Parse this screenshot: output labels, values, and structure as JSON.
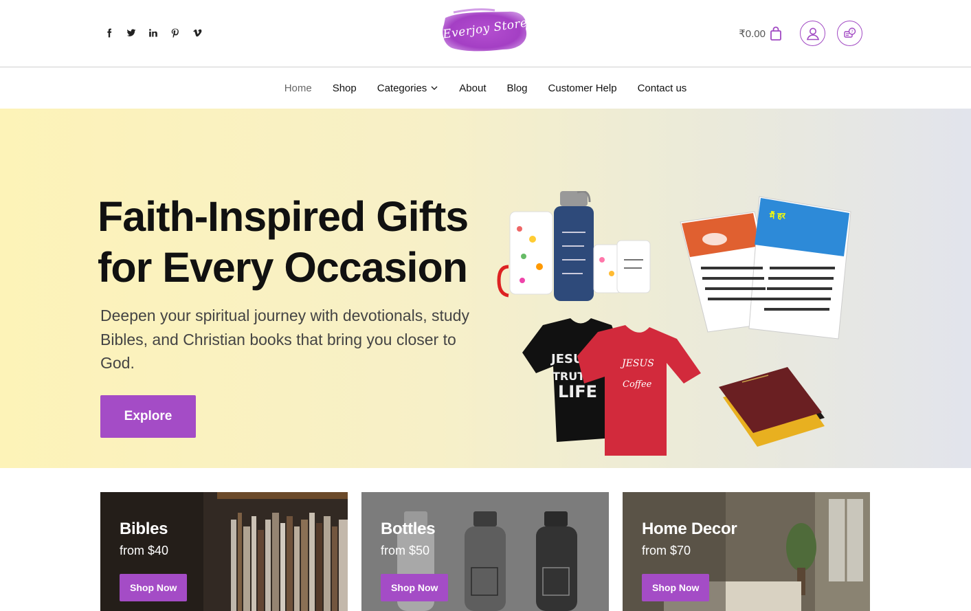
{
  "header": {
    "social_icons": [
      "facebook-icon",
      "twitter-icon",
      "linkedin-icon",
      "pinterest-icon",
      "vimeo-icon"
    ],
    "logo_text": "Everjoy Store",
    "cart_amount": "₹0.00",
    "icons": [
      "shopping-bag-icon",
      "user-account-icon",
      "support-chat-icon"
    ]
  },
  "nav": {
    "items": [
      "Home",
      "Shop",
      "Categories",
      "About",
      "Blog",
      "Customer Help",
      "Contact us"
    ]
  },
  "hero": {
    "title_line1": "Faith-Inspired Gifts",
    "title_line2": "for Every Occasion",
    "subtitle": "Deepen your spiritual journey with devotionals, study Bibles, and Christian books that bring you closer to God.",
    "button": "Explore"
  },
  "cards": [
    {
      "title": "Bibles",
      "price": "from $40",
      "button": "Shop Now"
    },
    {
      "title": "Bottles",
      "price": "from $50",
      "button": "Shop Now"
    },
    {
      "title": "Home Decor",
      "price": "from $70",
      "button": "Shop Now"
    }
  ],
  "colors": {
    "accent": "#a44cc6",
    "hero_gradient_start": "#fdf3b8",
    "hero_gradient_end": "#e2e4ec"
  }
}
